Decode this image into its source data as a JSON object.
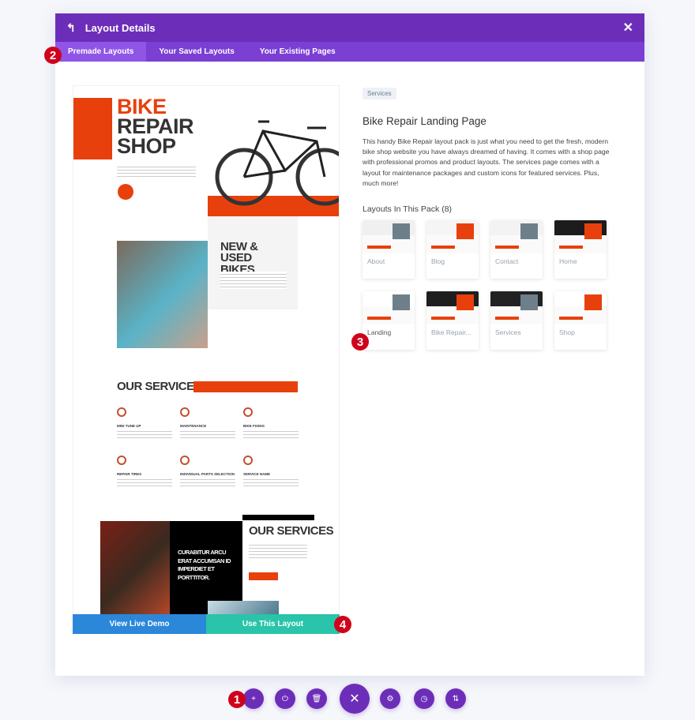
{
  "header": {
    "title": "Layout Details",
    "back_icon": "back-arrow-icon",
    "close_icon": "close-icon"
  },
  "tabs": [
    {
      "label": "Premade Layouts",
      "active": true
    },
    {
      "label": "Your Saved Layouts"
    },
    {
      "label": "Your Existing Pages"
    }
  ],
  "preview": {
    "hero_line1": "BIKE",
    "hero_line2": "REPAIR",
    "hero_line3": "SHOP",
    "section2": "NEW & USED BIKES",
    "services_title": "OUR SERVICES",
    "services": [
      "MINI TUNE UP",
      "MAINTENANCE",
      "BIKE FIXING",
      "REPAIR TIRES",
      "INDIVIDUAL PARTS SELECTION",
      "SERVICE NAME"
    ],
    "quote": "CURABITUR ARCU ERAT ACCUMSAN ID IMPERDIET ET PORTTITOR.",
    "services_title2": "OUR SERVICES",
    "accent": "#e8400c"
  },
  "actions": {
    "view_demo": "View Live Demo",
    "use_layout": "Use This Layout",
    "demo_color": "#2b87da",
    "use_color": "#29c4a9"
  },
  "details": {
    "category": "Services",
    "title": "Bike Repair Landing Page",
    "description": "This handy Bike Repair layout pack is just what you need to get the fresh, modern bike shop website you have always dreamed of having. It comes with a shop page with professional promos and product layouts. The services page comes with a layout for maintenance packages and custom icons for featured services. Plus, much more!",
    "pack_heading": "Layouts In This Pack (8)",
    "layouts": [
      "About",
      "Blog",
      "Contact",
      "Home",
      "Landing",
      "Bike Repair...",
      "Services",
      "Shop"
    ]
  },
  "markers": [
    "1",
    "2",
    "3",
    "4"
  ],
  "toolbar": {
    "buttons": [
      "plus-icon",
      "power-icon",
      "trash-icon",
      "close-icon",
      "gear-icon",
      "history-icon",
      "sort-icon"
    ],
    "color": "#6c2eb9"
  }
}
